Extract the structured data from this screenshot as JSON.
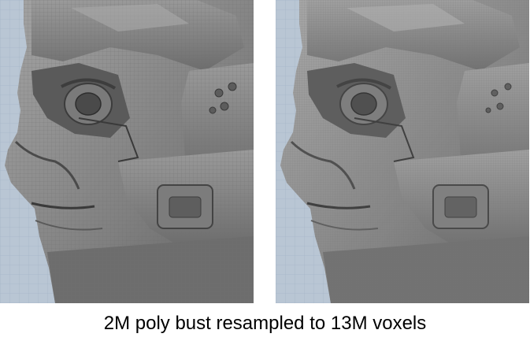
{
  "caption": "2M poly bust resampled to 13M voxels",
  "colors": {
    "background_sky": "#b9c6d4",
    "grid_line": "#9fb0c3",
    "mesh_gray": "#8f8f8f",
    "mesh_dark": "#4d4d4d",
    "mesh_light": "#b8b8b8"
  },
  "images": [
    {
      "subject": "polygon-mesh-bust-closeup",
      "style": "wireframe-shaded"
    },
    {
      "subject": "voxel-resampled-bust-closeup",
      "style": "voxel-shaded"
    }
  ]
}
